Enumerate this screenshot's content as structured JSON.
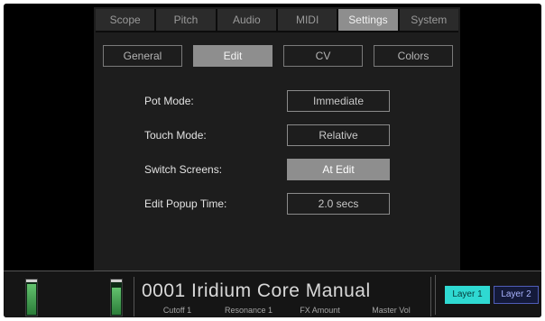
{
  "top_tabs": [
    "Scope",
    "Pitch",
    "Audio",
    "MIDI",
    "Settings",
    "System"
  ],
  "top_tab_active": "Settings",
  "sub_tabs": [
    "General",
    "Edit",
    "CV",
    "Colors"
  ],
  "sub_tab_active": "Edit",
  "settings": [
    {
      "label": "Pot Mode:",
      "value": "Immediate"
    },
    {
      "label": "Touch Mode:",
      "value": "Relative"
    },
    {
      "label": "Switch Screens:",
      "value": "At Edit"
    },
    {
      "label": "Edit Popup Time:",
      "value": "2.0 secs"
    }
  ],
  "preset": {
    "name": "0001 Iridium Core Manual",
    "params": [
      "Cutoff 1",
      "Resonance 1",
      "FX Amount",
      "Master Vol"
    ]
  },
  "meters": {
    "input": 0.85,
    "output": 0.75
  },
  "layers": {
    "layer1": "Layer 1",
    "layer2": "Layer 2",
    "active": "Layer 1"
  },
  "colors": {
    "active_tab": "#8e8e8e",
    "layer1": "#2fd9d2",
    "layer2": "#4f5db8",
    "meter_green": "#63c26e"
  }
}
